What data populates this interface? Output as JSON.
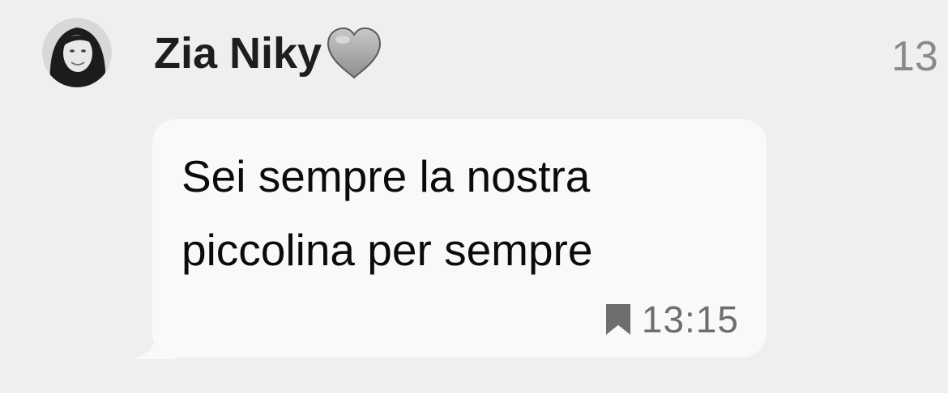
{
  "sender": {
    "name": "Zia Niky",
    "avatar_icon": "profile-photo-avatar",
    "emoji_icon": "grey-heart-icon"
  },
  "header": {
    "time_partial": "13"
  },
  "message": {
    "lines": [
      "Sei sempre la nostra",
      "piccolina per sempre"
    ],
    "time": "13:15",
    "status_icon": "bookmark-icon"
  },
  "colors": {
    "background": "#efefef",
    "bubble": "#f9f9f9",
    "text": "#0b0b0b",
    "meta": "#6e6e6e"
  }
}
